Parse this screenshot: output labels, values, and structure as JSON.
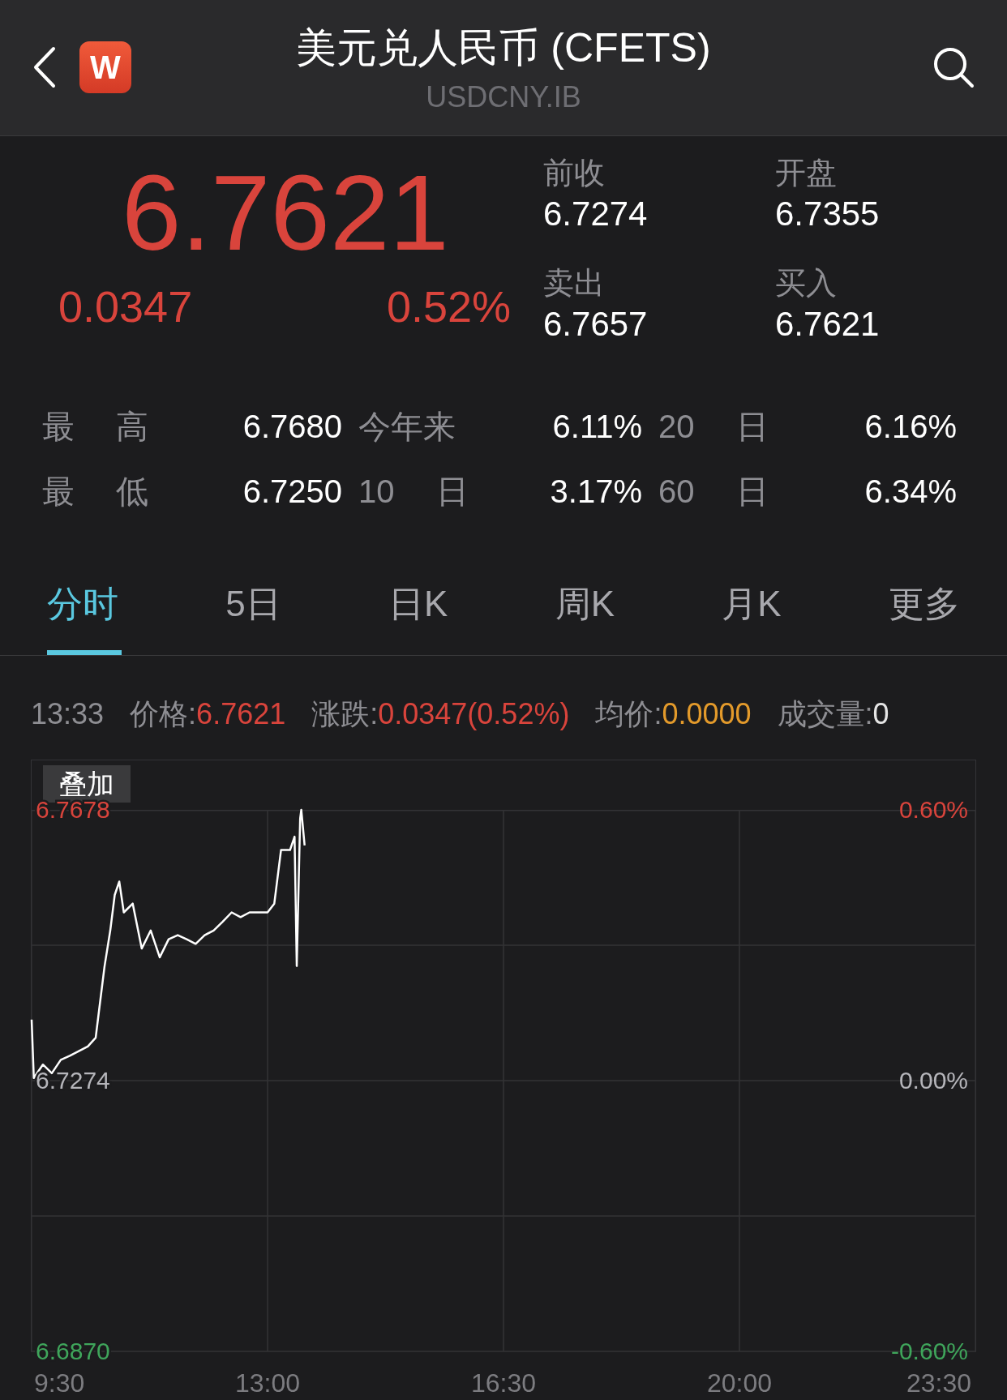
{
  "header": {
    "title": "美元兑人民币 (CFETS)",
    "subtitle": "USDCNY.IB",
    "logo_text": "W"
  },
  "quote": {
    "price": "6.7621",
    "change": "0.0347",
    "change_pct": "0.52%",
    "fields": [
      {
        "label": "前收",
        "value": "6.7274"
      },
      {
        "label": "开盘",
        "value": "6.7355"
      },
      {
        "label": "卖出",
        "value": "6.7657"
      },
      {
        "label": "买入",
        "value": "6.7621"
      }
    ]
  },
  "stats": [
    {
      "label": "最 高",
      "value": "6.7680"
    },
    {
      "label": "今年来",
      "value": "6.11%"
    },
    {
      "label": "20 日",
      "value": "6.16%"
    },
    {
      "label": "最 低",
      "value": "6.7250"
    },
    {
      "label": "10 日",
      "value": "3.17%"
    },
    {
      "label": "60 日",
      "value": "6.34%"
    }
  ],
  "tabs": [
    {
      "label": "分时",
      "selected": true
    },
    {
      "label": "5日",
      "selected": false
    },
    {
      "label": "日K",
      "selected": false
    },
    {
      "label": "周K",
      "selected": false
    },
    {
      "label": "月K",
      "selected": false
    },
    {
      "label": "更多",
      "selected": false
    }
  ],
  "info_time": "13:33",
  "info_line": [
    {
      "label": "价格:",
      "value": "6.7621",
      "kind": "rise"
    },
    {
      "label": "涨跌:",
      "value": "0.0347(0.52%)",
      "kind": "rise"
    },
    {
      "label": "均价:",
      "value": "0.0000",
      "kind": "average"
    },
    {
      "label": "成交量:",
      "value": "0",
      "kind": "plain"
    }
  ],
  "overlay_button": "叠加",
  "chart": {
    "right_ticks": [
      "0.60%",
      "0.00%",
      "-0.60%"
    ],
    "chart_data": {
      "type": "line",
      "x": [
        9.5,
        9.533,
        9.667,
        9.8,
        9.933,
        10.067,
        10.2,
        10.333,
        10.45,
        10.5,
        10.583,
        10.667,
        10.733,
        10.8,
        10.867,
        11,
        11.133,
        11.267,
        11.4,
        11.533,
        11.667,
        11.8,
        11.933,
        12.067,
        12.2,
        12.333,
        12.467,
        12.6,
        12.733,
        12.867,
        13,
        13.1,
        13.2,
        13.333,
        13.4,
        13.433,
        13.483,
        13.5,
        13.55
      ],
      "series": [
        {
          "color": "#ffffff",
          "values": [
            6.7365,
            6.7278,
            6.7298,
            6.7285,
            6.7305,
            6.7311,
            6.7318,
            6.7325,
            6.7338,
            6.7378,
            6.7445,
            6.7498,
            6.7551,
            6.7571,
            6.7525,
            6.7538,
            6.7471,
            6.7498,
            6.7458,
            6.7485,
            6.7491,
            6.7485,
            6.7478,
            6.7491,
            6.7498,
            6.7511,
            6.7525,
            6.7518,
            6.7525,
            6.7525,
            6.7525,
            6.7538,
            6.7618,
            6.7618,
            6.7638,
            6.7445,
            6.7665,
            6.7678,
            6.7625
          ]
        }
      ],
      "xlim": [
        9.5,
        23.5
      ],
      "grid": true,
      "ylim": [
        6.687,
        6.7678
      ],
      "xticks": [
        {
          "value": 9.5,
          "label": "9:30"
        },
        {
          "value": 13,
          "label": "13:00"
        },
        {
          "value": 16.5,
          "label": "16:30"
        },
        {
          "value": 20,
          "label": "20:00"
        },
        {
          "value": 23.5,
          "label": "23:30"
        }
      ],
      "yticks": [
        {
          "value": 6.7678,
          "label": "6.7678"
        },
        {
          "value": 6.7274,
          "label": "6.7274"
        },
        {
          "value": 6.687,
          "label": "6.6870"
        }
      ]
    }
  }
}
